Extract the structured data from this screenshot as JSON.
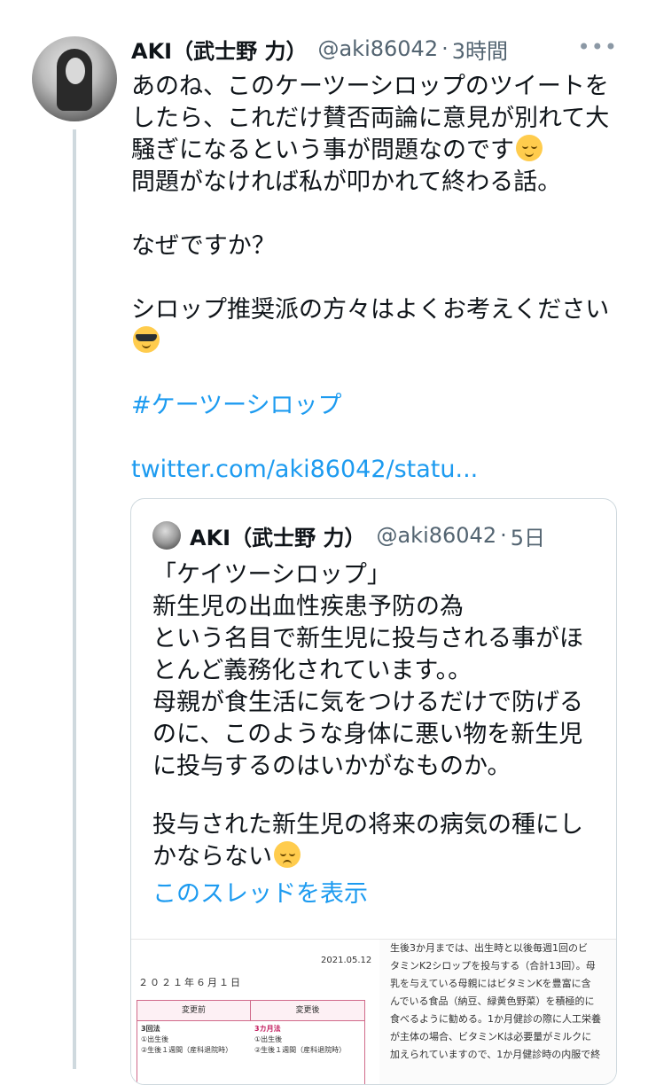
{
  "tweet": {
    "author_name": "AKI（武士野 力）",
    "handle": "@aki86042",
    "separator": "·",
    "time": "3時間",
    "more_label": "•••",
    "lines": [
      "あのね、このケーツーシロップのツイートを",
      "したら、これだけ賛否両論に意見が別れて大",
      "騒ぎになるという事が問題なのです",
      "問題がなければ私が叩かれて終わる話。",
      "",
      "なぜですか？",
      "",
      "シロップ推奨派の方々はよくお考えください",
      ""
    ],
    "hashtag": "#ケーツーシロップ",
    "link": "twitter.com/aki86042/statu..."
  },
  "quote": {
    "author_name": "AKI（武士野 力）",
    "handle": "@aki86042",
    "separator": "·",
    "time": "5日",
    "lines": [
      "「ケイツーシロップ」",
      "新生児の出血性疾患予防の為",
      "という名目で新生児に投与される事がほ",
      "とんど義務化されています。。",
      "母親が食生活に気をつけるだけで防げる",
      "のに、このような身体に悪い物を新生児",
      "に投与するのはいかがなものか。"
    ],
    "lines2": [
      "投与された新生児の将来の病気の種にし",
      "かならない"
    ],
    "show_thread": "このスレッドを表示"
  },
  "media": {
    "date": "2021.05.12",
    "title": "２０２１年６月１日",
    "col_before": "変更前",
    "col_after": "変更後",
    "before_lines": [
      "3回法",
      "①出生後",
      "②生後１週間（産科退院時）"
    ],
    "after_lines": [
      "3カ月法",
      "①出生後",
      "②生後１週間（産科退院時）"
    ],
    "right_lines": [
      "生後3か月までは、出生時と以後毎週1回のビ",
      "タミンK2シロップを投与する（合計13回）。母",
      "乳を与えている母親にはビタミンKを豊富に含",
      "んでいる食品（納豆、緑黄色野菜）を積極的に",
      "食べるように勧める。1か月健診の際に人工栄養",
      "が主体の場合、ビタミンKは必要量がミルクに",
      "加えられていますので、1か月健診時の内服で終"
    ]
  },
  "colors": {
    "link": "#1d9bf0",
    "secondary": "#536471",
    "border": "#cfd9de"
  }
}
